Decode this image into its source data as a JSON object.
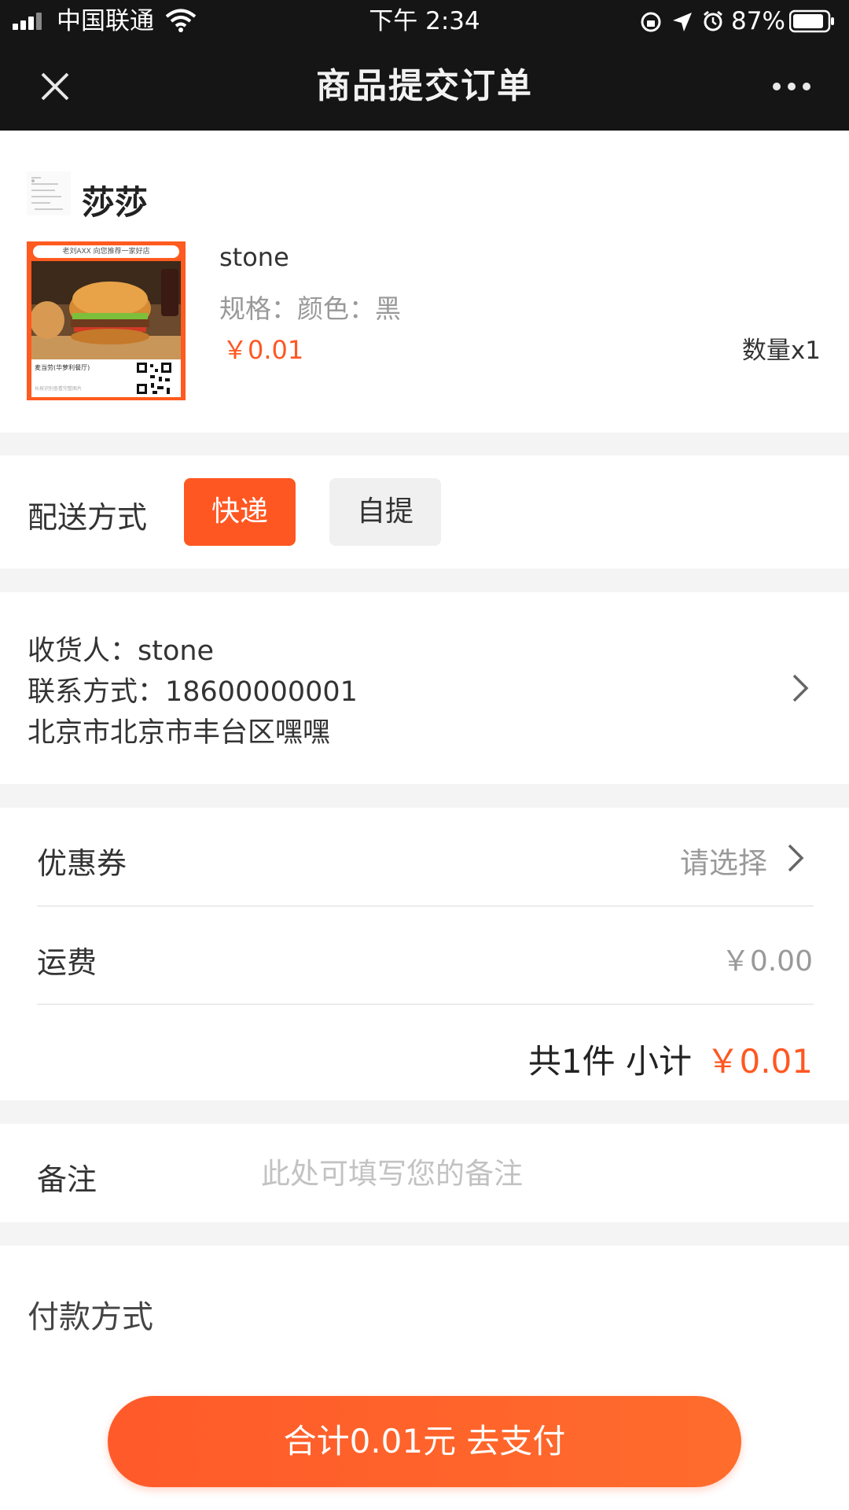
{
  "status_bar": {
    "carrier": "中国联通",
    "time": "下午 2:34",
    "battery": "87%"
  },
  "nav": {
    "title": "商品提交订单"
  },
  "shop": {
    "name": "莎莎"
  },
  "product": {
    "name": "stone",
    "spec": "规格：颜色：黑",
    "price": "￥0.01",
    "quantity": "数量x1",
    "thumbnail": {
      "banner": "老刘AXX  向您推荐一家好店",
      "caption": "麦当劳(华萝利餐厅)",
      "note": "长按识别查看完整图片"
    }
  },
  "delivery": {
    "label": "配送方式",
    "options": [
      "快递",
      "自提"
    ],
    "selected": "快递"
  },
  "address": {
    "recipient": "收货人：stone",
    "phone": "联系方式：18600000001",
    "address": "北京市北京市丰台区嘿嘿"
  },
  "coupon": {
    "label": "优惠券",
    "value": "请选择"
  },
  "shipping": {
    "label": "运费",
    "value": "￥0.00"
  },
  "summary": {
    "count_text": "共1件 小计",
    "subtotal": "￥0.01"
  },
  "remark": {
    "label": "备注",
    "placeholder": "此处可填写您的备注"
  },
  "payment": {
    "label": "付款方式"
  },
  "pay_button": {
    "label": "合计0.01元 去支付"
  },
  "colors": {
    "accent": "#ff5722",
    "nav_bg": "#151515",
    "page_bg": "#f4f4f4"
  }
}
